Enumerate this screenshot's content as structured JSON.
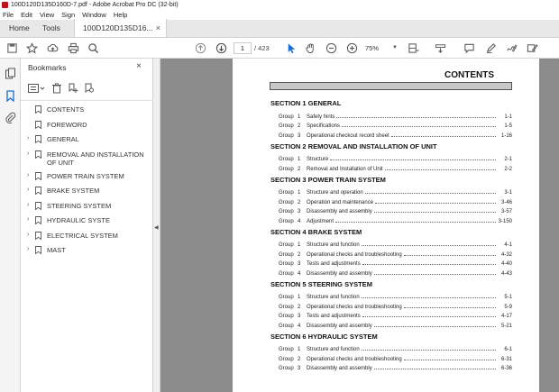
{
  "window": {
    "title": "100D120D135D160D-7.pdf - Adobe Acrobat Pro DC (32-bit)"
  },
  "menu": [
    "File",
    "Edit",
    "View",
    "Sign",
    "Window",
    "Help"
  ],
  "tabs": {
    "home": "Home",
    "tools": "Tools",
    "doc": "100D120D135D16...",
    "close": "×"
  },
  "toolbar": {
    "page": "1",
    "total": "/ 423",
    "zoom": "75%"
  },
  "panel": {
    "title": "Bookmarks",
    "close": "×",
    "items": [
      {
        "label": "CONTENTS",
        "expandable": false
      },
      {
        "label": "FOREWORD",
        "expandable": false
      },
      {
        "label": "GENERAL",
        "expandable": true
      },
      {
        "label": "REMOVAL AND INSTALLATION OF UNIT",
        "expandable": true
      },
      {
        "label": "POWER TRAIN SYSTEM",
        "expandable": true
      },
      {
        "label": "BRAKE SYSTEM",
        "expandable": true
      },
      {
        "label": "STEERING SYSTEM",
        "expandable": true
      },
      {
        "label": "HYDRAULIC SYSTE",
        "expandable": true
      },
      {
        "label": "ELECTRICAL SYSTEM",
        "expandable": true
      },
      {
        "label": "MAST",
        "expandable": true
      }
    ]
  },
  "doc": {
    "heading": "CONTENTS",
    "sections": [
      {
        "title": "SECTION 1  GENERAL",
        "entries": [
          {
            "group": "Group",
            "num": "1",
            "title": "Safety hints",
            "page": "1-1"
          },
          {
            "group": "Group",
            "num": "2",
            "title": "Specifications",
            "page": "1-5"
          },
          {
            "group": "Group",
            "num": "3",
            "title": "Operational checkout record sheet",
            "page": "1-16"
          }
        ]
      },
      {
        "title": "SECTION 2  REMOVAL AND INSTALLATION OF UNIT",
        "entries": [
          {
            "group": "Group",
            "num": "1",
            "title": "Structure",
            "page": "2-1"
          },
          {
            "group": "Group",
            "num": "2",
            "title": "Removal and Installation of Unit",
            "page": "2-2"
          }
        ]
      },
      {
        "title": "SECTION 3  POWER TRAIN SYSTEM",
        "entries": [
          {
            "group": "Group",
            "num": "1",
            "title": "Structure and operation",
            "page": "3-1"
          },
          {
            "group": "Group",
            "num": "2",
            "title": "Operation and maintenance",
            "page": "3-46"
          },
          {
            "group": "Group",
            "num": "3",
            "title": "Disassembly and assembly",
            "page": "3-57"
          },
          {
            "group": "Group",
            "num": "4",
            "title": "Adjustment",
            "page": "3-150"
          }
        ]
      },
      {
        "title": "SECTION 4  BRAKE SYSTEM",
        "entries": [
          {
            "group": "Group",
            "num": "1",
            "title": "Structure and function",
            "page": "4-1"
          },
          {
            "group": "Group",
            "num": "2",
            "title": "Operational checks and troubleshooting",
            "page": "4-32"
          },
          {
            "group": "Group",
            "num": "3",
            "title": "Tests and adjustments",
            "page": "4-40"
          },
          {
            "group": "Group",
            "num": "4",
            "title": "Disassembly and assembly",
            "page": "4-43"
          }
        ]
      },
      {
        "title": "SECTION 5  STEERING SYSTEM",
        "entries": [
          {
            "group": "Group",
            "num": "1",
            "title": "Structure and function",
            "page": "5-1"
          },
          {
            "group": "Group",
            "num": "2",
            "title": "Operational checks and troubleshooting",
            "page": "5-9"
          },
          {
            "group": "Group",
            "num": "3",
            "title": "Tests and adjustments",
            "page": "4-17"
          },
          {
            "group": "Group",
            "num": "4",
            "title": "Disassembly and assembly",
            "page": "5-21"
          }
        ]
      },
      {
        "title": "SECTION 6  HYDRAULIC SYSTEM",
        "entries": [
          {
            "group": "Group",
            "num": "1",
            "title": "Structure and function",
            "page": "6-1"
          },
          {
            "group": "Group",
            "num": "2",
            "title": "Operational checks and troubleshooting",
            "page": "6-31"
          },
          {
            "group": "Group",
            "num": "3",
            "title": "Disassembly and assembly",
            "page": "6-36"
          }
        ]
      }
    ]
  }
}
